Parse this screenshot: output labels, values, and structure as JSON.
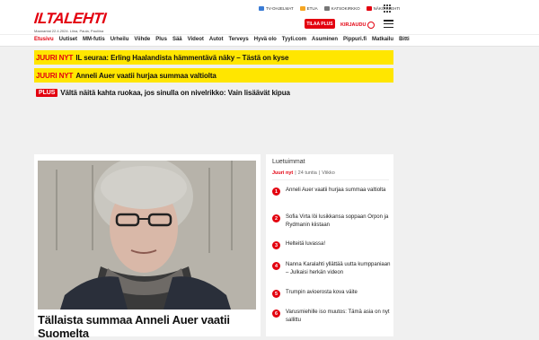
{
  "header": {
    "logo": "ILTALEHTI",
    "dateline": "Maanantai 22.4.2024. Liina, Paula, Pauliina",
    "top_links": [
      "TV-OHJELMAT",
      "ETUA",
      "KATSOKIRKKO",
      "NÄKÖISLEHTI"
    ],
    "buy_label": "TILAA PLUS",
    "login_label": "KIRJAUDU"
  },
  "nav": {
    "items": [
      "Etusivu",
      "Uutiset",
      "MM-futis",
      "Urheilu",
      "Viihde",
      "Plus",
      "Sää",
      "Videot",
      "Autot",
      "Terveys",
      "Hyvä olo",
      "Tyyli.com",
      "Asuminen",
      "Pippuri.fi",
      "Matkailu",
      "Bitti"
    ]
  },
  "news": [
    {
      "tag": "JUURI NYT",
      "text": "IL seuraa: Erling Haalandista hämmentävä näky – Tästä on kyse"
    },
    {
      "tag": "JUURI NYT",
      "text": "Anneli Auer vaatii hurjaa summaa valtiolta"
    },
    {
      "tag": "PLUS",
      "text": "Vältä näitä kahta ruokaa, jos sinulla on nivelrikko: Vain lisäävät kipua"
    }
  ],
  "main": {
    "headline": "Tällaista summaa Anneli Auer vaatii Suomelta"
  },
  "sidebar": {
    "title": "Luetuimmat",
    "tabs": [
      "Juuri nyt",
      "24 tuntia",
      "Viikko"
    ],
    "items": [
      {
        "rank": "1",
        "text": "Anneli Auer vaatii hurjaa summaa valtiolta"
      },
      {
        "rank": "2",
        "text": "Sofia Virta löi lusikkansa soppaan Orpon ja Rydmanin kiistaan"
      },
      {
        "rank": "3",
        "text": "Helteitä luvassa!"
      },
      {
        "rank": "4",
        "text": "Nanna Karalahti yllättää uutta kumppaniaan – Julkaisi herkän videon"
      },
      {
        "rank": "5",
        "text": "Trumpin avioerosta kova väite"
      },
      {
        "rank": "6",
        "text": "Varusmiehille iso muutos: Tämä asia on nyt sallittu"
      }
    ]
  },
  "colors": {
    "brand": "#e3000f",
    "highlight": "#ffe600"
  }
}
